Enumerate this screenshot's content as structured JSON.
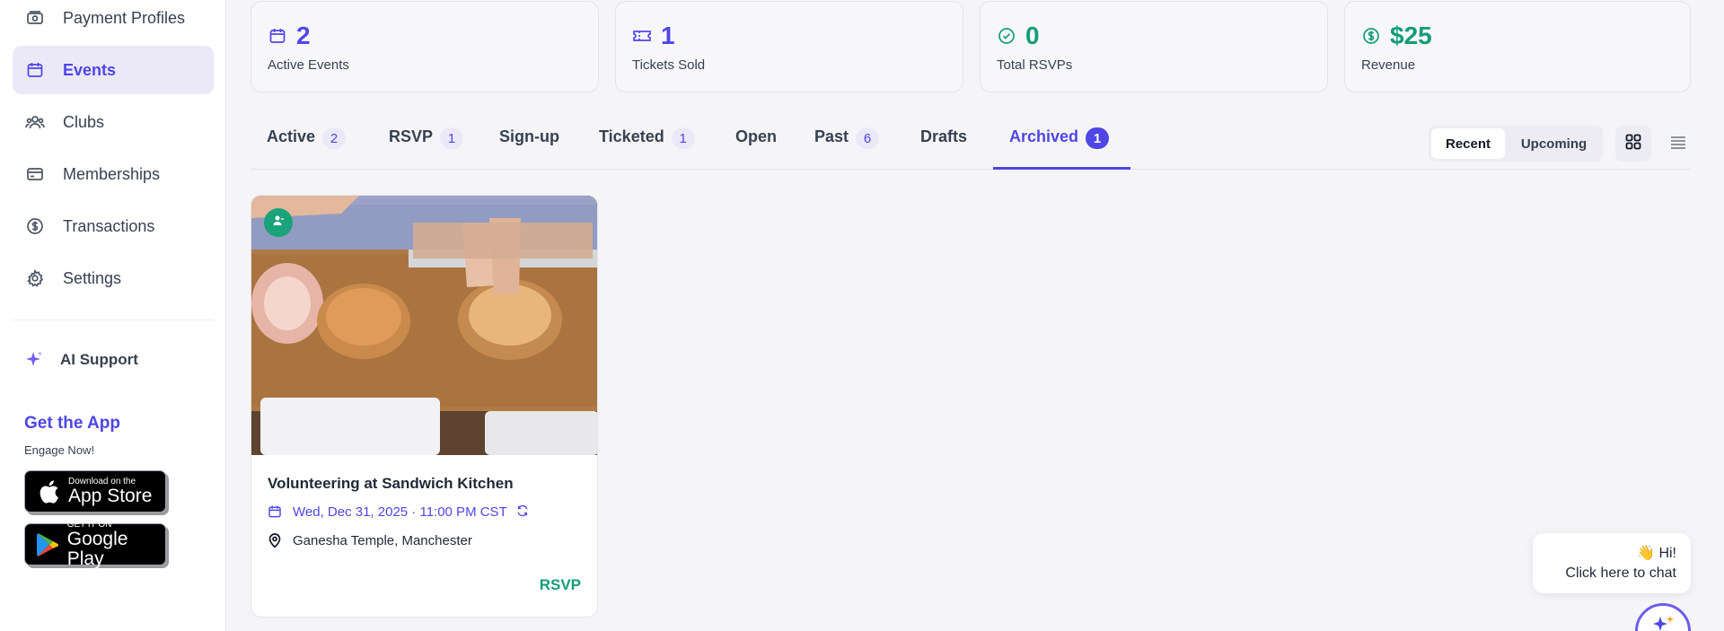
{
  "sidebar": {
    "items": [
      {
        "label": "Payment Profiles",
        "icon": "payment-icon"
      },
      {
        "label": "Events",
        "icon": "calendar-icon",
        "active": true
      },
      {
        "label": "Clubs",
        "icon": "users-icon"
      },
      {
        "label": "Memberships",
        "icon": "card-icon"
      },
      {
        "label": "Transactions",
        "icon": "dollar-circle-icon"
      },
      {
        "label": "Settings",
        "icon": "gear-icon"
      }
    ],
    "ai_support": "AI Support",
    "get_app": "Get the App",
    "engage": "Engage Now!",
    "app_store": {
      "small": "Download on the",
      "big": "App Store"
    },
    "google_play": {
      "small": "GET IT ON",
      "big": "Google Play"
    }
  },
  "stats": [
    {
      "value": "2",
      "label": "Active Events",
      "icon": "calendar-icon",
      "color": "#4f46e5"
    },
    {
      "value": "1",
      "label": "Tickets Sold",
      "icon": "ticket-icon",
      "color": "#4f46e5"
    },
    {
      "value": "0",
      "label": "Total RSVPs",
      "icon": "check-circle-icon",
      "color": "#169c7a"
    },
    {
      "value": "$25",
      "label": "Revenue",
      "icon": "dollar-circle-icon",
      "color": "#169c7a"
    }
  ],
  "tabs": [
    {
      "label": "Active",
      "count": "2"
    },
    {
      "label": "RSVP",
      "count": "1"
    },
    {
      "label": "Sign-up"
    },
    {
      "label": "Ticketed",
      "count": "1"
    },
    {
      "label": "Open"
    },
    {
      "label": "Past",
      "count": "6"
    },
    {
      "label": "Drafts"
    },
    {
      "label": "Archived",
      "count": "1",
      "active": true
    }
  ],
  "sort": {
    "recent": "Recent",
    "upcoming": "Upcoming",
    "selected": "Recent"
  },
  "events": [
    {
      "title": "Volunteering at Sandwich Kitchen",
      "datetime": "Wed, Dec 31, 2025 · 11:00 PM CST",
      "location": "Ganesha Temple, Manchester",
      "type": "RSVP"
    }
  ],
  "chat": {
    "greeting": "👋 Hi!",
    "prompt": "Click here to chat"
  },
  "colors": {
    "accent": "#4f46e5",
    "green": "#169c7a",
    "active_bg": "#ebe9f7"
  }
}
